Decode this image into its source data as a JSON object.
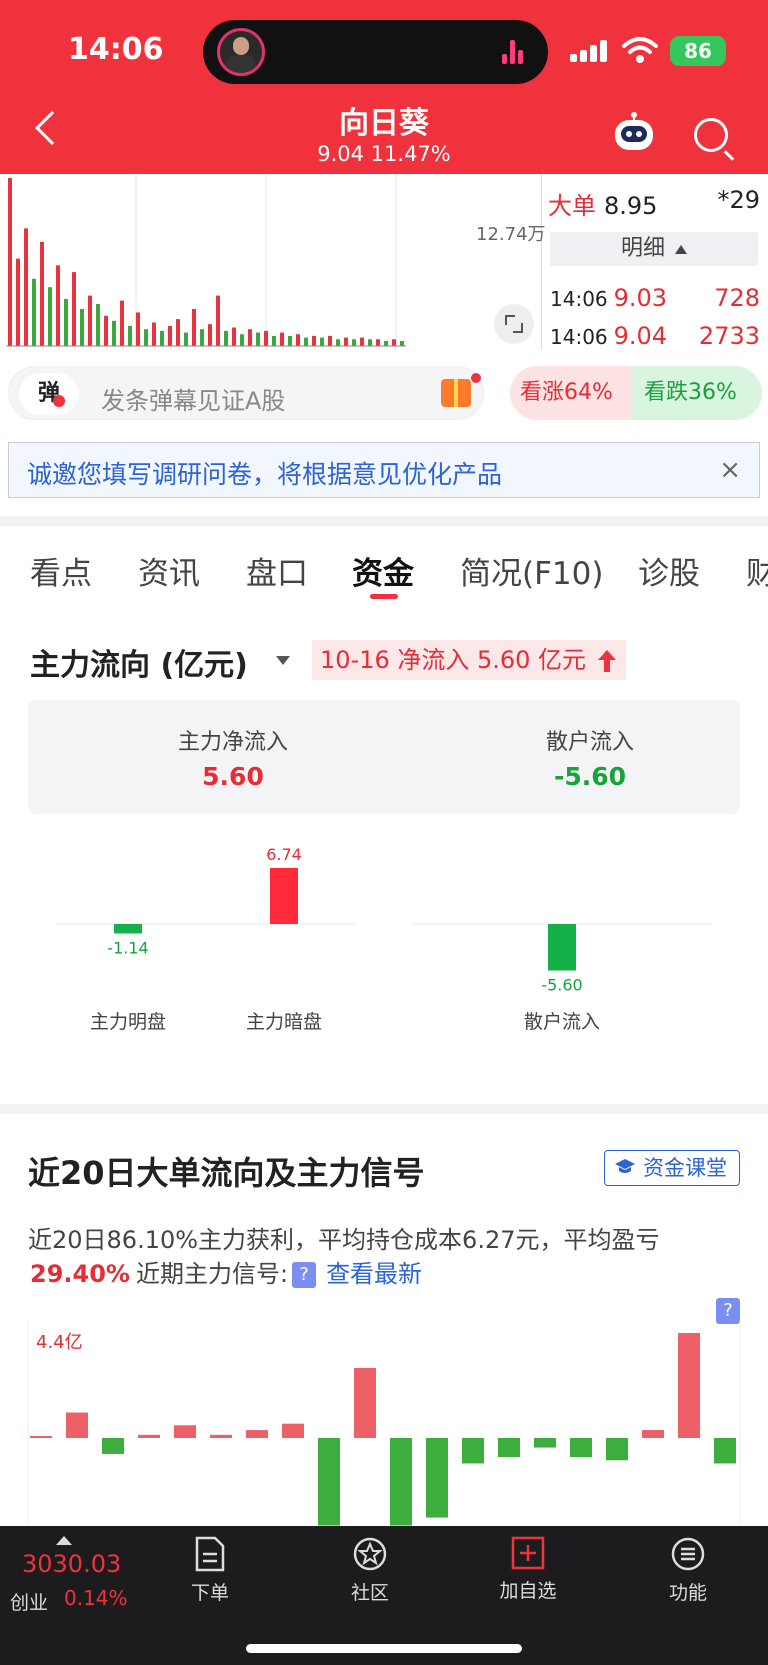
{
  "status": {
    "time": "14:06",
    "battery": "86"
  },
  "header": {
    "title": "向日葵",
    "subtitle": "9.04 11.47%"
  },
  "volume": {
    "max_label": "12.74万",
    "bars": [
      {
        "v": 1.0,
        "c": "r"
      },
      {
        "v": 0.52,
        "c": "r"
      },
      {
        "v": 0.7,
        "c": "r"
      },
      {
        "v": 0.4,
        "c": "g"
      },
      {
        "v": 0.62,
        "c": "r"
      },
      {
        "v": 0.35,
        "c": "g"
      },
      {
        "v": 0.48,
        "c": "r"
      },
      {
        "v": 0.28,
        "c": "g"
      },
      {
        "v": 0.44,
        "c": "r"
      },
      {
        "v": 0.22,
        "c": "g"
      },
      {
        "v": 0.3,
        "c": "r"
      },
      {
        "v": 0.25,
        "c": "g"
      },
      {
        "v": 0.18,
        "c": "r"
      },
      {
        "v": 0.15,
        "c": "g"
      },
      {
        "v": 0.27,
        "c": "r"
      },
      {
        "v": 0.12,
        "c": "g"
      },
      {
        "v": 0.2,
        "c": "r"
      },
      {
        "v": 0.1,
        "c": "g"
      },
      {
        "v": 0.14,
        "c": "r"
      },
      {
        "v": 0.09,
        "c": "g"
      },
      {
        "v": 0.12,
        "c": "r"
      },
      {
        "v": 0.16,
        "c": "r"
      },
      {
        "v": 0.08,
        "c": "g"
      },
      {
        "v": 0.22,
        "c": "r"
      },
      {
        "v": 0.1,
        "c": "g"
      },
      {
        "v": 0.13,
        "c": "r"
      },
      {
        "v": 0.3,
        "c": "r"
      },
      {
        "v": 0.09,
        "c": "g"
      },
      {
        "v": 0.11,
        "c": "r"
      },
      {
        "v": 0.07,
        "c": "g"
      },
      {
        "v": 0.1,
        "c": "r"
      },
      {
        "v": 0.08,
        "c": "g"
      },
      {
        "v": 0.09,
        "c": "r"
      },
      {
        "v": 0.06,
        "c": "g"
      },
      {
        "v": 0.08,
        "c": "r"
      },
      {
        "v": 0.06,
        "c": "g"
      },
      {
        "v": 0.07,
        "c": "r"
      },
      {
        "v": 0.05,
        "c": "g"
      },
      {
        "v": 0.06,
        "c": "r"
      },
      {
        "v": 0.05,
        "c": "g"
      },
      {
        "v": 0.06,
        "c": "r"
      },
      {
        "v": 0.04,
        "c": "g"
      },
      {
        "v": 0.05,
        "c": "r"
      },
      {
        "v": 0.04,
        "c": "g"
      },
      {
        "v": 0.05,
        "c": "r"
      },
      {
        "v": 0.04,
        "c": "g"
      },
      {
        "v": 0.04,
        "c": "r"
      },
      {
        "v": 0.03,
        "c": "g"
      },
      {
        "v": 0.04,
        "c": "r"
      },
      {
        "v": 0.03,
        "c": "g"
      }
    ]
  },
  "ticks": {
    "big_label": "大单",
    "big_value": "8.95",
    "big_count": "*29",
    "detail_label": "明细",
    "rows": [
      {
        "time": "14:06",
        "price": "9.03",
        "vol": "728"
      },
      {
        "time": "14:06",
        "price": "9.04",
        "vol": "2733"
      }
    ]
  },
  "danmu": {
    "icon_label": "弹",
    "placeholder": "发条弹幕见证A股"
  },
  "vote": {
    "up": "看涨64%",
    "down": "看跌36%"
  },
  "survey": {
    "text": "诚邀您填写调研问卷，将根据意见优化产品",
    "close": "×"
  },
  "tabs": [
    "看点",
    "资讯",
    "盘口",
    "资金",
    "简况(F10)",
    "诊股",
    "财"
  ],
  "flow": {
    "title": "主力流向 (亿元)",
    "tag": "10-16 净流入 5.60 亿元",
    "main_label": "主力净流入",
    "main_value": "5.60",
    "retail_label": "散户流入",
    "retail_value": "-5.60",
    "colors": {
      "up": "#ff2a3a",
      "down": "#14b04a"
    }
  },
  "chart_data": {
    "type": "bar",
    "categories": [
      "主力明盘",
      "主力暗盘",
      "散户流入"
    ],
    "values": [
      -1.14,
      6.74,
      -5.6
    ],
    "labels": [
      "-1.14",
      "6.74",
      "-5.60"
    ]
  },
  "section20": {
    "title": "近20日大单流向及主力信号",
    "course_button": "资金课堂",
    "desc1": "近20日86.10%主力获利，平均持仓成本6.27元，平均盈亏",
    "desc2_pct": "29.40%",
    "desc2_text": "近期主力信号:",
    "q_icon": "?",
    "see_latest": "查看最新",
    "ymax_label": "4.4亿",
    "values": [
      0.1,
      1.6,
      -1.0,
      0.2,
      0.8,
      0.2,
      0.5,
      0.9,
      -5.5,
      4.4,
      -5.5,
      -5.0,
      -1.6,
      -1.2,
      -0.6,
      -1.2,
      -1.4,
      0.5,
      6.6,
      -1.6
    ]
  },
  "bottom": {
    "index_value": "3030.03",
    "index_name": "创业",
    "index_change": "0.14%",
    "items": [
      "下单",
      "社区",
      "加自选",
      "功能"
    ]
  }
}
